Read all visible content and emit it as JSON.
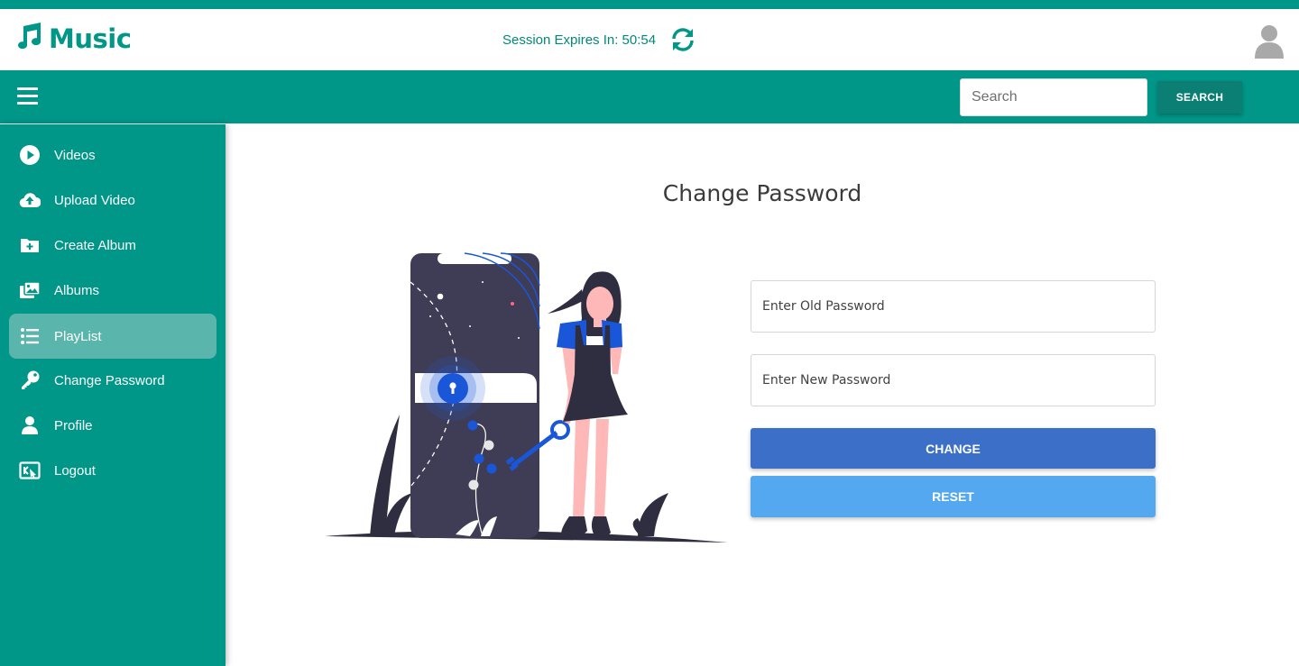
{
  "app": {
    "name": "Music"
  },
  "header": {
    "session_text": "Session Expires In: 50:54",
    "refresh_icon": "sync-icon",
    "avatar_icon": "user-avatar-icon"
  },
  "navbar": {
    "menu_icon": "hamburger-icon",
    "search": {
      "placeholder": "Search",
      "value": "",
      "button_label": "SEARCH"
    }
  },
  "sidebar": {
    "items": [
      {
        "label": "Videos",
        "icon": "play-circle-icon",
        "active": false
      },
      {
        "label": "Upload Video",
        "icon": "cloud-upload-icon",
        "active": false
      },
      {
        "label": "Create Album",
        "icon": "folder-plus-icon",
        "active": false
      },
      {
        "label": "Albums",
        "icon": "images-icon",
        "active": false
      },
      {
        "label": "PlayList",
        "icon": "list-icon",
        "active": true
      },
      {
        "label": "Change Password",
        "icon": "key-icon",
        "active": false
      },
      {
        "label": "Profile",
        "icon": "user-icon",
        "active": false
      },
      {
        "label": "Logout",
        "icon": "logout-icon",
        "active": false
      }
    ]
  },
  "main": {
    "title": "Change Password",
    "old_password": {
      "placeholder": "Enter Old Password",
      "value": ""
    },
    "new_password": {
      "placeholder": "Enter New Password",
      "value": ""
    },
    "change_label": "CHANGE",
    "reset_label": "RESET"
  },
  "colors": {
    "primary": "#009688",
    "active_item": "#5ab5ac",
    "change_button": "#3b6fc8",
    "reset_button": "#54a8ef"
  }
}
